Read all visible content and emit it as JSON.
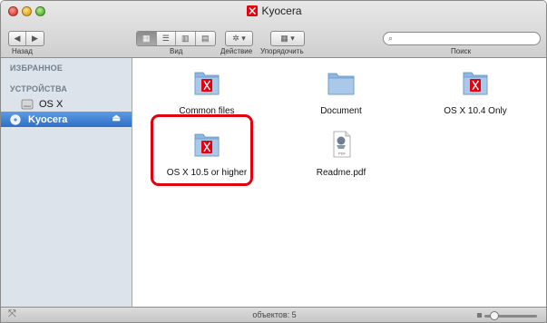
{
  "window": {
    "title": "Kyocera"
  },
  "toolbar": {
    "back_label": "Назад",
    "view_label": "Вид",
    "action_label": "Действие",
    "arrange_label": "Упорядочить",
    "search_label": "Поиск",
    "search_value": "",
    "view_mode_selected": "icons"
  },
  "sidebar": {
    "favorites_header": "ИЗБРАННОЕ",
    "devices_header": "УСТРОЙСТВА",
    "items": [
      {
        "label": "OS X",
        "icon": "hard-disk-icon",
        "selected": false
      },
      {
        "label": "Kyocera",
        "icon": "disc-icon",
        "selected": true
      }
    ]
  },
  "files": [
    {
      "name": "Common files",
      "icon": "kyocera-folder-icon"
    },
    {
      "name": "Document",
      "icon": "folder-icon"
    },
    {
      "name": "OS X 10.4 Only",
      "icon": "kyocera-folder-icon"
    },
    {
      "name": "OS X 10.5 or higher",
      "icon": "kyocera-folder-icon",
      "highlighted": true
    },
    {
      "name": "Readme.pdf",
      "icon": "pdf-icon"
    }
  ],
  "status": {
    "count_text": "объектов: 5"
  },
  "colors": {
    "highlight": "#e3000f",
    "kyocera_red": "#e3000f",
    "sidebar_selected": "#2e6fc8"
  }
}
